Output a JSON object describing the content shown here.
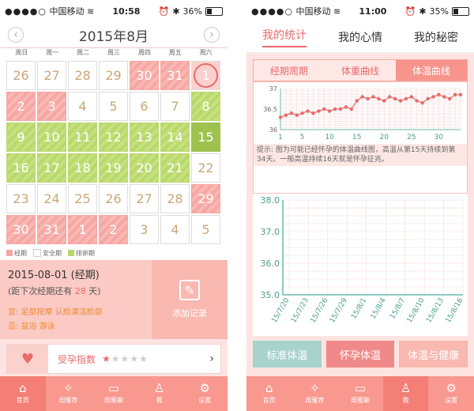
{
  "left": {
    "status": {
      "carrier": "中国移动",
      "time": "10:58",
      "battery": "36%",
      "battery_level": 0.36
    },
    "calendar": {
      "title": "2015年8月",
      "weekdays": [
        "周日",
        "周一",
        "周二",
        "周三",
        "周四",
        "周五",
        "周六"
      ],
      "days": [
        {
          "d": "26",
          "t": "empty"
        },
        {
          "d": "27",
          "t": "empty"
        },
        {
          "d": "28",
          "t": "empty"
        },
        {
          "d": "29",
          "t": "empty"
        },
        {
          "d": "30",
          "t": "period"
        },
        {
          "d": "31",
          "t": "period"
        },
        {
          "d": "1",
          "t": "today"
        },
        {
          "d": "2",
          "t": "period"
        },
        {
          "d": "3",
          "t": "period"
        },
        {
          "d": "4",
          "t": "safe"
        },
        {
          "d": "5",
          "t": "safe"
        },
        {
          "d": "6",
          "t": "safe"
        },
        {
          "d": "7",
          "t": "safe"
        },
        {
          "d": "8",
          "t": "ovul"
        },
        {
          "d": "9",
          "t": "ovul"
        },
        {
          "d": "10",
          "t": "ovul"
        },
        {
          "d": "11",
          "t": "ovul"
        },
        {
          "d": "12",
          "t": "ovul"
        },
        {
          "d": "13",
          "t": "ovul"
        },
        {
          "d": "14",
          "t": "ovul"
        },
        {
          "d": "15",
          "t": "ovuldark"
        },
        {
          "d": "16",
          "t": "ovul"
        },
        {
          "d": "17",
          "t": "ovul"
        },
        {
          "d": "18",
          "t": "ovul"
        },
        {
          "d": "19",
          "t": "ovul"
        },
        {
          "d": "20",
          "t": "ovul"
        },
        {
          "d": "21",
          "t": "ovul"
        },
        {
          "d": "22",
          "t": "safe"
        },
        {
          "d": "23",
          "t": "safe"
        },
        {
          "d": "24",
          "t": "safe"
        },
        {
          "d": "25",
          "t": "safe"
        },
        {
          "d": "26",
          "t": "safe"
        },
        {
          "d": "27",
          "t": "safe"
        },
        {
          "d": "28",
          "t": "safe"
        },
        {
          "d": "29",
          "t": "period"
        },
        {
          "d": "30",
          "t": "period"
        },
        {
          "d": "31",
          "t": "period"
        },
        {
          "d": "1",
          "t": "period"
        },
        {
          "d": "2",
          "t": "period"
        },
        {
          "d": "3",
          "t": "empty"
        },
        {
          "d": "4",
          "t": "empty"
        },
        {
          "d": "5",
          "t": "empty"
        }
      ]
    },
    "legend": {
      "period": "经期",
      "safe": "安全期",
      "ovulation": "排卵期"
    },
    "info": {
      "date": "2015-08-01 (经期)",
      "sub_prefix": "(距下次经期还有",
      "sub_days": "28",
      "sub_suffix": "天)",
      "do": "宜: 足部按摩 认脸清洁脸部",
      "avoid": "忌: 盆浴 游泳"
    },
    "add_label": "添加记录",
    "preg_label": "受孕指数",
    "preg_stars": {
      "filled": 1,
      "total": 5
    },
    "tabs": [
      "首页",
      "闺蜜荐",
      "闺蜜聊",
      "我",
      "设置"
    ]
  },
  "right": {
    "status": {
      "carrier": "中国移动",
      "time": "11:00",
      "battery": "35%",
      "battery_level": 0.35
    },
    "top_tabs": [
      "我的统计",
      "我的心情",
      "我的秘密"
    ],
    "sub_tabs": [
      "经期周期",
      "体重曲线",
      "体温曲线"
    ],
    "tip": "提示: 图为可能已经怀孕的体温曲线图，高温从第15天持续到第34天。一般高温持续16天就是怀孕征兆。",
    "buttons": [
      {
        "label": "标准体温",
        "color": "#a7d3cc"
      },
      {
        "label": "怀孕体温",
        "color": "#f08a8a"
      },
      {
        "label": "体温与健康",
        "color": "#f9b8b0"
      }
    ],
    "tabs": [
      "首页",
      "闺蜜荐",
      "闺蜜聊",
      "我",
      "设置"
    ]
  },
  "chart_data": [
    {
      "type": "line",
      "x": [
        1,
        2,
        3,
        4,
        5,
        6,
        7,
        8,
        9,
        10,
        11,
        12,
        13,
        14,
        15,
        16,
        17,
        18,
        19,
        20,
        21,
        22,
        23,
        24,
        25,
        26,
        27,
        28,
        29,
        30,
        31,
        32,
        33,
        34
      ],
      "series": [
        {
          "values": [
            36.3,
            36.35,
            36.4,
            36.35,
            36.4,
            36.45,
            36.4,
            36.45,
            36.5,
            36.45,
            36.5,
            36.5,
            36.55,
            36.5,
            36.7,
            36.8,
            36.75,
            36.8,
            36.75,
            36.7,
            36.8,
            36.75,
            36.7,
            36.75,
            36.8,
            36.7,
            36.65,
            36.75,
            36.8,
            36.85,
            36.8,
            36.75,
            36.85,
            36.85
          ]
        }
      ],
      "yticks": [
        "37",
        "36.5",
        "36"
      ],
      "xticks": [
        "1",
        "5",
        "10",
        "15",
        "20",
        "25",
        "30"
      ],
      "ylim": [
        36,
        37
      ]
    },
    {
      "type": "line",
      "yticks": [
        "38.0",
        "37.0",
        "36.0",
        "35.0"
      ],
      "xticks": [
        "15/7/20",
        "15/7/23",
        "15/7/26",
        "15/7/29",
        "15/8/1",
        "15/8/4",
        "15/8/7",
        "15/8/10",
        "15/8/13",
        "15/8/16"
      ],
      "ylim": [
        35,
        38
      ],
      "x": [],
      "series": []
    }
  ]
}
